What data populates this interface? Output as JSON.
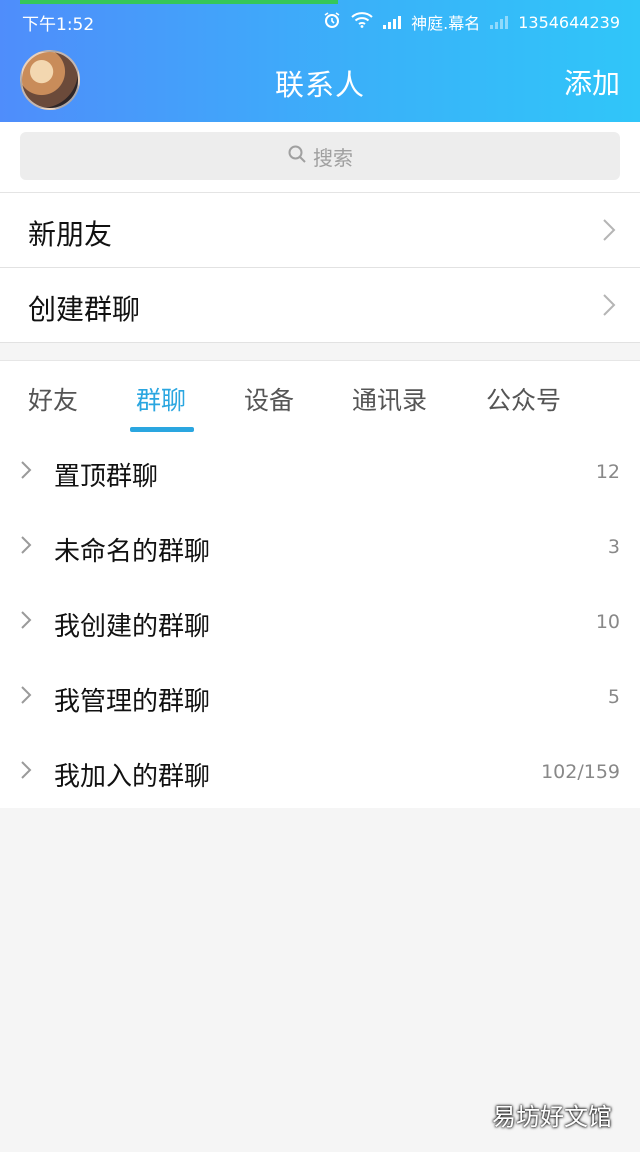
{
  "status_bar": {
    "time": "下午1:52",
    "carrier": "神庭.幕名",
    "phone": "1354644239"
  },
  "header": {
    "title": "联系人",
    "add_label": "添加"
  },
  "search": {
    "placeholder": "搜索"
  },
  "menu": [
    {
      "label": "新朋友"
    },
    {
      "label": "创建群聊"
    }
  ],
  "tabs": [
    {
      "label": "好友",
      "active": false
    },
    {
      "label": "群聊",
      "active": true
    },
    {
      "label": "设备",
      "active": false
    },
    {
      "label": "通讯录",
      "active": false
    },
    {
      "label": "公众号",
      "active": false
    }
  ],
  "groups": [
    {
      "name": "置顶群聊",
      "count": "12"
    },
    {
      "name": "未命名的群聊",
      "count": "3"
    },
    {
      "name": "我创建的群聊",
      "count": "10"
    },
    {
      "name": "我管理的群聊",
      "count": "5"
    },
    {
      "name": "我加入的群聊",
      "count": "102/159"
    }
  ],
  "watermark": "易坊好文馆",
  "colors": {
    "accent": "#2aa6e0",
    "header_start": "#4f8dfb",
    "header_end": "#30c6f9"
  }
}
